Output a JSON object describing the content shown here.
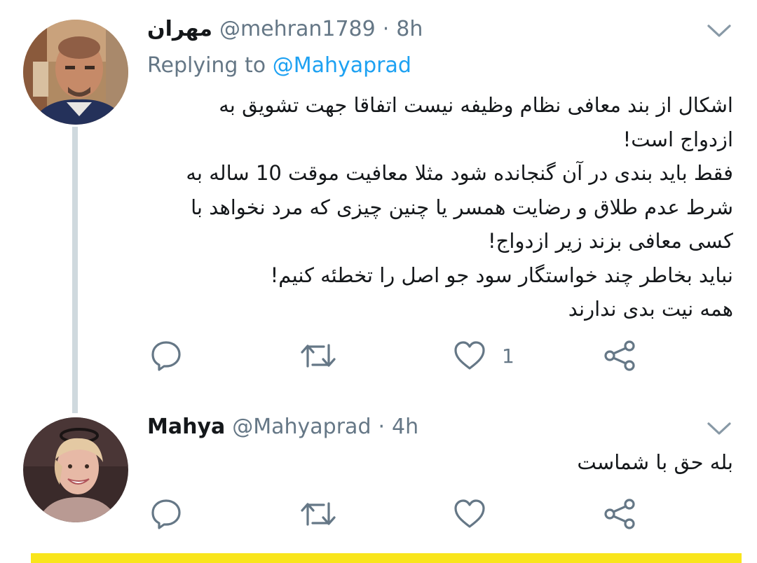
{
  "tweets": [
    {
      "name": "مهران",
      "handle": "@mehran1789",
      "separator": "·",
      "time": "8h",
      "replying_label": "Replying to",
      "replying_to": "@Mahyaprad",
      "lines": [
        "اشکال از بند معافی نظام وظیفه نیست اتفاقا جهت تشویق به",
        "ازدواج است!",
        "فقط باید بندی در آن گنجانده شود مثلا معافیت موقت 10 ساله به",
        "شرط عدم طلاق و رضایت همسر یا چنین چیزی که مرد نخواهد با",
        "کسی معافی بزند زیر ازدواج!",
        "نباید بخاطر چند خواستگار سود جو اصل را تخطئه کنیم!",
        "همه نیت بدی ندارند"
      ],
      "like_count": "1"
    },
    {
      "name": "Mahya",
      "handle": "@Mahyaprad",
      "separator": "·",
      "time": "4h",
      "lines": [
        "بله حق با شماست"
      ],
      "like_count": ""
    }
  ],
  "icons": {
    "reply": "reply-icon",
    "retweet": "retweet-icon",
    "like": "heart-icon",
    "share": "share-icon",
    "more": "chevron-down-icon"
  },
  "colors": {
    "text": "#14171a",
    "secondary": "#657786",
    "link": "#1da1f2",
    "thread_line": "#cfd9de",
    "bottom_bar": "#f9e51b"
  }
}
